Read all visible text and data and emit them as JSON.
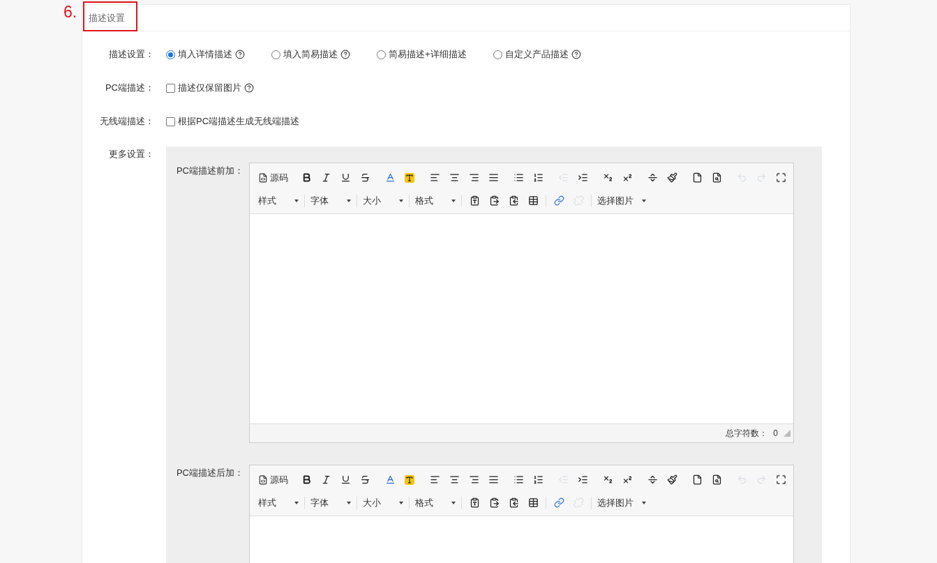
{
  "section": {
    "number": "6.",
    "title": "描述设置"
  },
  "fields": [
    {
      "kind": "radio",
      "label": "描述设置：",
      "options": [
        {
          "label": "填入详情描述",
          "selected": true,
          "help": true
        },
        {
          "label": "填入简易描述",
          "selected": false,
          "help": true
        },
        {
          "label": "简易描述+详细描述",
          "selected": false,
          "help": false
        },
        {
          "label": "自定义产品描述",
          "selected": false,
          "help": true
        }
      ]
    },
    {
      "kind": "checkbox",
      "label": "PC端描述：",
      "options": [
        {
          "label": "描述仅保留图片",
          "checked": false,
          "help": true
        }
      ]
    },
    {
      "kind": "checkbox",
      "label": "无线端描述：",
      "options": [
        {
          "label": "根据PC端描述生成无线端描述",
          "checked": false,
          "help": false
        }
      ]
    }
  ],
  "more": {
    "label": "更多设置：",
    "editors": [
      {
        "label": "PC端描述前加：",
        "footer": {
          "label": "总字符数：",
          "count": "0"
        },
        "toolbar": [
          [
            [
              {
                "kind": "source",
                "label": "源码",
                "disabled": false
              }
            ],
            [
              {
                "kind": "bold",
                "disabled": false
              },
              {
                "kind": "italic",
                "disabled": false
              },
              {
                "kind": "underline",
                "disabled": false
              },
              {
                "kind": "strike",
                "disabled": false
              }
            ],
            [
              {
                "kind": "fontcolor",
                "disabled": false
              },
              {
                "kind": "highlight",
                "disabled": false
              }
            ],
            [
              {
                "kind": "alignleft",
                "disabled": false
              },
              {
                "kind": "aligncenter",
                "disabled": false
              },
              {
                "kind": "alignright",
                "disabled": false
              },
              {
                "kind": "justify",
                "disabled": false
              }
            ],
            [
              {
                "kind": "bullets",
                "disabled": false
              },
              {
                "kind": "numbers",
                "disabled": false
              }
            ],
            [
              {
                "kind": "outdent",
                "disabled": true
              },
              {
                "kind": "indent",
                "disabled": false
              }
            ],
            [
              {
                "kind": "subscript",
                "disabled": false
              },
              {
                "kind": "superscript",
                "disabled": false
              }
            ],
            [
              {
                "kind": "rule",
                "disabled": false
              },
              {
                "kind": "painter",
                "disabled": false
              }
            ],
            [
              {
                "kind": "newdoc",
                "disabled": false
              },
              {
                "kind": "preview",
                "disabled": false
              }
            ],
            [
              {
                "kind": "undo",
                "disabled": true
              },
              {
                "kind": "redo",
                "disabled": true
              },
              {
                "kind": "fullscreen",
                "disabled": false
              }
            ]
          ],
          [
            [
              {
                "kind": "dropdown",
                "label": "样式",
                "disabled": false
              }
            ],
            [
              {
                "kind": "dropdown",
                "label": "字体",
                "disabled": false
              }
            ],
            [
              {
                "kind": "dropdown",
                "label": "大小",
                "disabled": false
              }
            ],
            [
              {
                "kind": "dropdown",
                "label": "格式",
                "disabled": false
              }
            ],
            [
              {
                "kind": "pastetext",
                "disabled": false
              },
              {
                "kind": "pasteimage",
                "disabled": false
              },
              {
                "kind": "pasteword",
                "disabled": false
              },
              {
                "kind": "table",
                "disabled": false
              }
            ],
            [
              {
                "kind": "link",
                "disabled": false
              },
              {
                "kind": "unlink",
                "disabled": true
              }
            ],
            [
              {
                "kind": "dropdown",
                "label": "选择图片",
                "disabled": false
              }
            ]
          ]
        ]
      },
      {
        "label": "PC端描述后加：",
        "toolbar": [
          [
            [
              {
                "kind": "source",
                "label": "源码",
                "disabled": false
              }
            ],
            [
              {
                "kind": "bold",
                "disabled": false
              },
              {
                "kind": "italic",
                "disabled": false
              },
              {
                "kind": "underline",
                "disabled": false
              },
              {
                "kind": "strike",
                "disabled": false
              }
            ],
            [
              {
                "kind": "fontcolor",
                "disabled": false
              },
              {
                "kind": "highlight",
                "disabled": false
              }
            ],
            [
              {
                "kind": "alignleft",
                "disabled": false
              },
              {
                "kind": "aligncenter",
                "disabled": false
              },
              {
                "kind": "alignright",
                "disabled": false
              },
              {
                "kind": "justify",
                "disabled": false
              }
            ],
            [
              {
                "kind": "bullets",
                "disabled": false
              },
              {
                "kind": "numbers",
                "disabled": false
              }
            ],
            [
              {
                "kind": "outdent",
                "disabled": true
              },
              {
                "kind": "indent",
                "disabled": false
              }
            ],
            [
              {
                "kind": "subscript",
                "disabled": false
              },
              {
                "kind": "superscript",
                "disabled": false
              }
            ],
            [
              {
                "kind": "rule",
                "disabled": false
              },
              {
                "kind": "painter",
                "disabled": false
              }
            ],
            [
              {
                "kind": "newdoc",
                "disabled": false
              },
              {
                "kind": "preview",
                "disabled": false
              }
            ],
            [
              {
                "kind": "undo",
                "disabled": true
              },
              {
                "kind": "redo",
                "disabled": true
              },
              {
                "kind": "fullscreen",
                "disabled": false
              }
            ]
          ],
          [
            [
              {
                "kind": "dropdown",
                "label": "样式",
                "disabled": false
              }
            ],
            [
              {
                "kind": "dropdown",
                "label": "字体",
                "disabled": false
              }
            ],
            [
              {
                "kind": "dropdown",
                "label": "大小",
                "disabled": false
              }
            ],
            [
              {
                "kind": "dropdown",
                "label": "格式",
                "disabled": false
              }
            ],
            [
              {
                "kind": "pastetext",
                "disabled": false
              },
              {
                "kind": "pasteimage",
                "disabled": false
              },
              {
                "kind": "pasteword",
                "disabled": false
              },
              {
                "kind": "table",
                "disabled": false
              }
            ],
            [
              {
                "kind": "link",
                "disabled": false
              },
              {
                "kind": "unlink",
                "disabled": true
              }
            ],
            [
              {
                "kind": "dropdown",
                "label": "选择图片",
                "disabled": false
              }
            ]
          ]
        ]
      }
    ]
  }
}
